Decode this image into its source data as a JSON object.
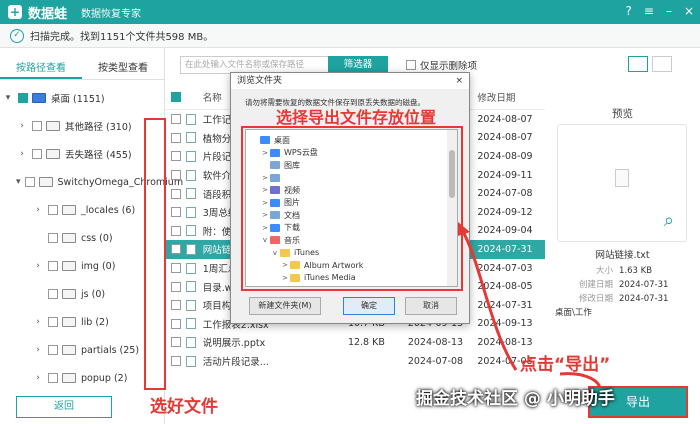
{
  "titlebar": {
    "app_name": "数据蛙",
    "subtitle": "数据恢复专家"
  },
  "status": {
    "text": "扫描完成。找到1151个文件共598 MB。"
  },
  "tabs": {
    "by_path": "按路径查看",
    "by_type": "按类型查看"
  },
  "tree": [
    {
      "label": "桌面 (1151)"
    },
    {
      "label": "其他路径 (310)"
    },
    {
      "label": "丢失路径 (455)"
    },
    {
      "label": "SwitchyOmega_Chromium"
    },
    {
      "label": "_locales (6)"
    },
    {
      "label": "css (0)"
    },
    {
      "label": "img (0)"
    },
    {
      "label": "js (0)"
    },
    {
      "label": "lib (2)"
    },
    {
      "label": "partials (25)"
    },
    {
      "label": "popup (2)"
    }
  ],
  "back_label": "返回",
  "search": {
    "placeholder": "在此处输入文件名称或保存路径"
  },
  "filter_label": "筛选器",
  "only_deleted": "仅显示删除项",
  "list_header": {
    "name": "名称",
    "date": "修改日期"
  },
  "rows": [
    {
      "name": "工作记录表.xlsx",
      "size": "",
      "type": "",
      "date": "2024-08-07",
      "selected": false
    },
    {
      "name": "植物分类.docx",
      "size": "",
      "type": "",
      "date": "2024-08-07",
      "selected": false
    },
    {
      "name": "片段记录.docx",
      "size": "",
      "type": "",
      "date": "2024-08-09",
      "selected": false
    },
    {
      "name": "软件介绍 - 副本",
      "size": "",
      "type": "",
      "date": "2024-09-11",
      "selected": false
    },
    {
      "name": "语段积累.docx",
      "size": "",
      "type": "",
      "date": "2024-07-08",
      "selected": false
    },
    {
      "name": "3周总结.docx",
      "size": "",
      "type": "",
      "date": "2024-09-12",
      "selected": false
    },
    {
      "name": "附：使用注意",
      "size": "",
      "type": "",
      "date": "2024-09-04",
      "selected": false
    },
    {
      "name": "网站链接.txt",
      "size": "",
      "type": "",
      "date": "2024-07-31",
      "selected": true
    },
    {
      "name": "1周汇总.docx",
      "size": "",
      "type": "",
      "date": "2024-07-03",
      "selected": false
    },
    {
      "name": "目录.wps",
      "size": "",
      "type": "",
      "date": "2024-08-05",
      "selected": false
    },
    {
      "name": "项目构思.docx",
      "size": "",
      "type": "",
      "date": "2024-07-31",
      "selected": false
    },
    {
      "name": "工作报表2.xlsx",
      "size": "10.7 KB",
      "type": "2024-09-13",
      "date": "2024-09-13",
      "selected": false
    },
    {
      "name": "说明展示.pptx",
      "size": "12.8 KB",
      "type": "2024-08-13",
      "date": "2024-08-13",
      "selected": false
    },
    {
      "name": "活动片段记录...",
      "size": "",
      "type": "2024-07-08",
      "date": "2024-07-08",
      "selected": false
    }
  ],
  "preview": {
    "title": "预览",
    "name": "网站链接.txt",
    "size_k": "大小",
    "size_v": "1.63 KB",
    "created_k": "创建日期",
    "created_v": "2024-07-31",
    "modified_k": "修改日期",
    "modified_v": "2024-07-31",
    "path_v": "桌面\\工作"
  },
  "dialog": {
    "title": "浏览文件夹",
    "desc": "请勿将需要恢复的数据文件保存到原丢失数据的磁盘。",
    "tree": [
      {
        "label": "桌面",
        "indent": 0,
        "exp": "",
        "ic": "b"
      },
      {
        "label": "WPS云盘",
        "indent": 1,
        "exp": ">",
        "ic": "b"
      },
      {
        "label": "图库",
        "indent": 1,
        "exp": "",
        "ic": "g"
      },
      {
        "label": "",
        "indent": 1,
        "exp": ">",
        "ic": "g"
      },
      {
        "label": "视频",
        "indent": 1,
        "exp": ">",
        "ic": "p"
      },
      {
        "label": "图片",
        "indent": 1,
        "exp": ">",
        "ic": "b"
      },
      {
        "label": "文档",
        "indent": 1,
        "exp": ">",
        "ic": "g"
      },
      {
        "label": "下载",
        "indent": 1,
        "exp": ">",
        "ic": "b"
      },
      {
        "label": "音乐",
        "indent": 1,
        "exp": "v",
        "ic": "r"
      },
      {
        "label": "iTunes",
        "indent": 2,
        "exp": "v",
        "ic": "f"
      },
      {
        "label": "Album Artwork",
        "indent": 3,
        "exp": ">",
        "ic": "f"
      },
      {
        "label": "iTunes Media",
        "indent": 3,
        "exp": ">",
        "ic": "f"
      }
    ],
    "new_folder": "新建文件夹(M)",
    "ok": "确定",
    "cancel": "取消"
  },
  "annotations": {
    "choose_location": "选择导出文件存放位置",
    "choose_files": "选好文件",
    "click_export": "点击“导出”"
  },
  "export_label": "导出",
  "watermark": "掘金技术社区 @ 小明助手",
  "colors": {
    "accent": "#1fa3a0",
    "annotation": "#e53935"
  }
}
